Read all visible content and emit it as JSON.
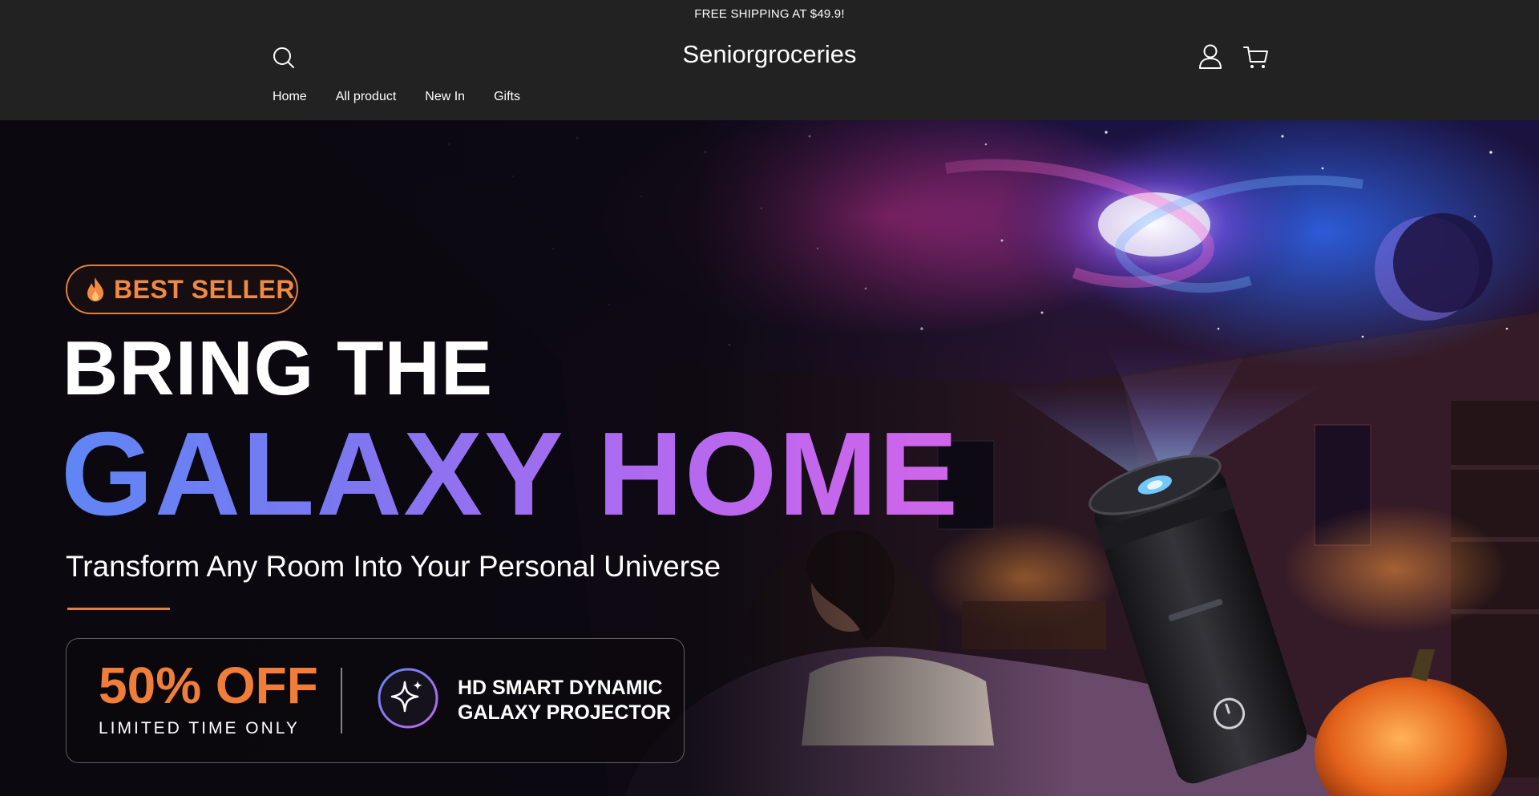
{
  "announcement": "FREE SHIPPING AT $49.9!",
  "header": {
    "logo": "Seniorgroceries",
    "icons": {
      "search": "search-icon",
      "account": "user-icon",
      "cart": "cart-icon"
    }
  },
  "nav": {
    "items": [
      {
        "label": "Home"
      },
      {
        "label": "All product"
      },
      {
        "label": "New In"
      },
      {
        "label": "Gifts"
      }
    ]
  },
  "hero": {
    "badge": "BEST SELLER",
    "badge_icon": "fire-icon",
    "headline_line1": "BRING THE",
    "headline_line2": "GALAXY HOME",
    "subheadline": "Transform Any Room Into Your Personal Universe",
    "promo": {
      "discount": "50% OFF",
      "tagline": "LIMITED TIME ONLY",
      "product_icon": "sparkle-icon",
      "product_line1": "HD SMART DYNAMIC",
      "product_line2": "GALAXY PROJECTOR"
    }
  },
  "colors": {
    "header_bg": "#222222",
    "accent_orange": "#f08a42",
    "headline_gradient_start": "#5f86f5",
    "headline_gradient_end": "#d066ea"
  }
}
